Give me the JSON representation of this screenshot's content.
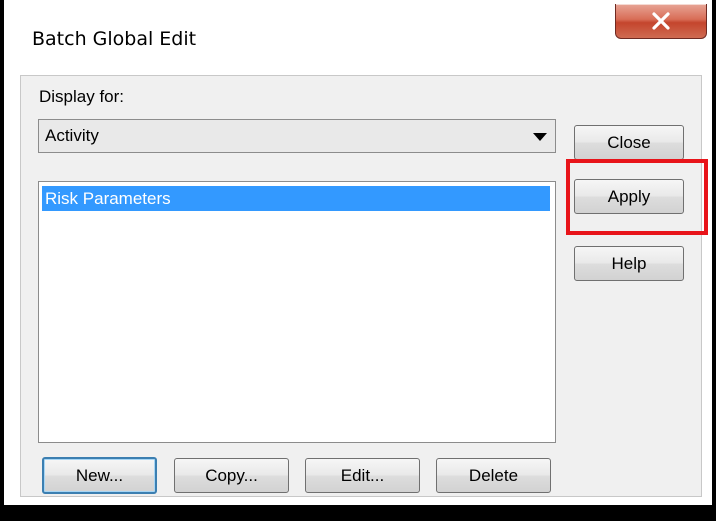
{
  "window": {
    "title": "Batch Global Edit",
    "close_icon": "close-x-icon"
  },
  "display_for": {
    "label": "Display for:",
    "selected": "Activity"
  },
  "list": {
    "items": [
      "Risk Parameters"
    ],
    "selected_index": 0
  },
  "side_buttons": {
    "close": "Close",
    "apply": "Apply",
    "help": "Help"
  },
  "bottom_buttons": {
    "new": "New...",
    "copy": "Copy...",
    "edit": "Edit...",
    "delete": "Delete"
  },
  "colors": {
    "selection": "#3399ff",
    "highlight_box": "#e8141a",
    "close_button": "#c4452d"
  }
}
